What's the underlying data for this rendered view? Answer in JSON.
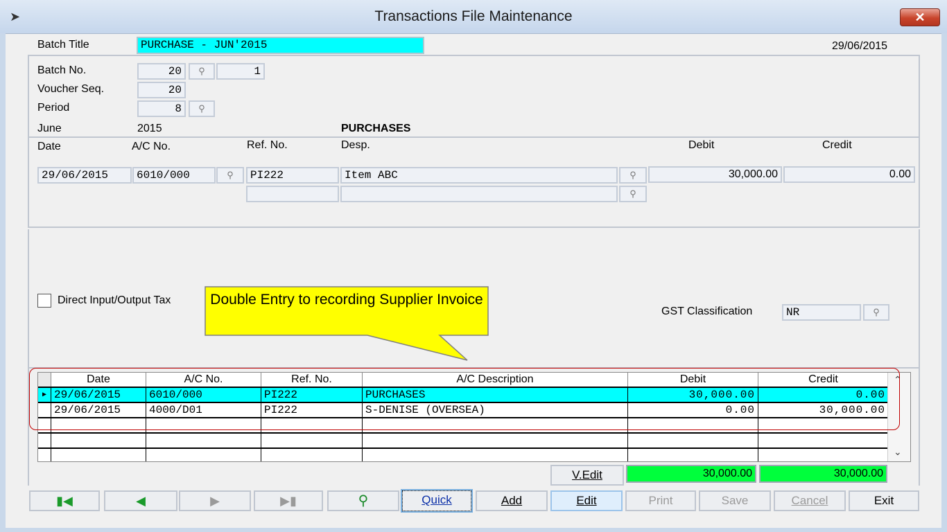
{
  "window": {
    "title": "Transactions File Maintenance",
    "close": "✕"
  },
  "header": {
    "batch_title_label": "Batch Title",
    "batch_title_value": "PURCHASE - JUN'2015",
    "date": "29/06/2015",
    "batch_no_label": "Batch No.",
    "batch_no_value": "20",
    "batch_sub_value": "1",
    "voucher_seq_label": "Voucher Seq.",
    "voucher_seq_value": "20",
    "period_label": "Period",
    "period_value": "8",
    "month": "June",
    "year": "2015",
    "account_name": "PURCHASES"
  },
  "entry": {
    "columns": {
      "date": "Date",
      "ac_no": "A/C No.",
      "ref_no": "Ref. No.",
      "desp": "Desp.",
      "debit": "Debit",
      "credit": "Credit"
    },
    "date": "29/06/2015",
    "ac_no": "6010/000",
    "ref_no": "PI222",
    "desp": "Item ABC",
    "debit": "30,000.00",
    "credit": "0.00",
    "ref_no_2": "",
    "desp_2": ""
  },
  "tax": {
    "direct_label": "Direct Input/Output Tax",
    "direct_checked": false,
    "gst_label": "GST Classification",
    "gst_value": "NR"
  },
  "callout": {
    "text": "Double Entry to recording Supplier Invoice"
  },
  "grid": {
    "headers": [
      "Date",
      "A/C No.",
      "Ref. No.",
      "A/C Description",
      "Debit",
      "Credit"
    ],
    "rows": [
      {
        "date": "29/06/2015",
        "ac_no": "6010/000",
        "ref": "PI222",
        "desc": "PURCHASES",
        "debit": "30,000.00",
        "credit": "0.00",
        "selected": true
      },
      {
        "date": "29/06/2015",
        "ac_no": "4000/D01",
        "ref": "PI222",
        "desc": "S-DENISE (OVERSEA)",
        "debit": "0.00",
        "credit": "30,000.00",
        "selected": false
      }
    ]
  },
  "totals": {
    "vedit_label": "V.Edit",
    "debit_total": "30,000.00",
    "credit_total": "30,000.00"
  },
  "toolbar": {
    "quick": "Quick",
    "add": "Add",
    "edit": "Edit",
    "print": "Print",
    "save": "Save",
    "cancel": "Cancel",
    "exit": "Exit"
  },
  "colors": {
    "highlight": "#00ffff",
    "total_green": "#00ff3c",
    "callout": "#ffff00",
    "annotation": "#c00000"
  }
}
